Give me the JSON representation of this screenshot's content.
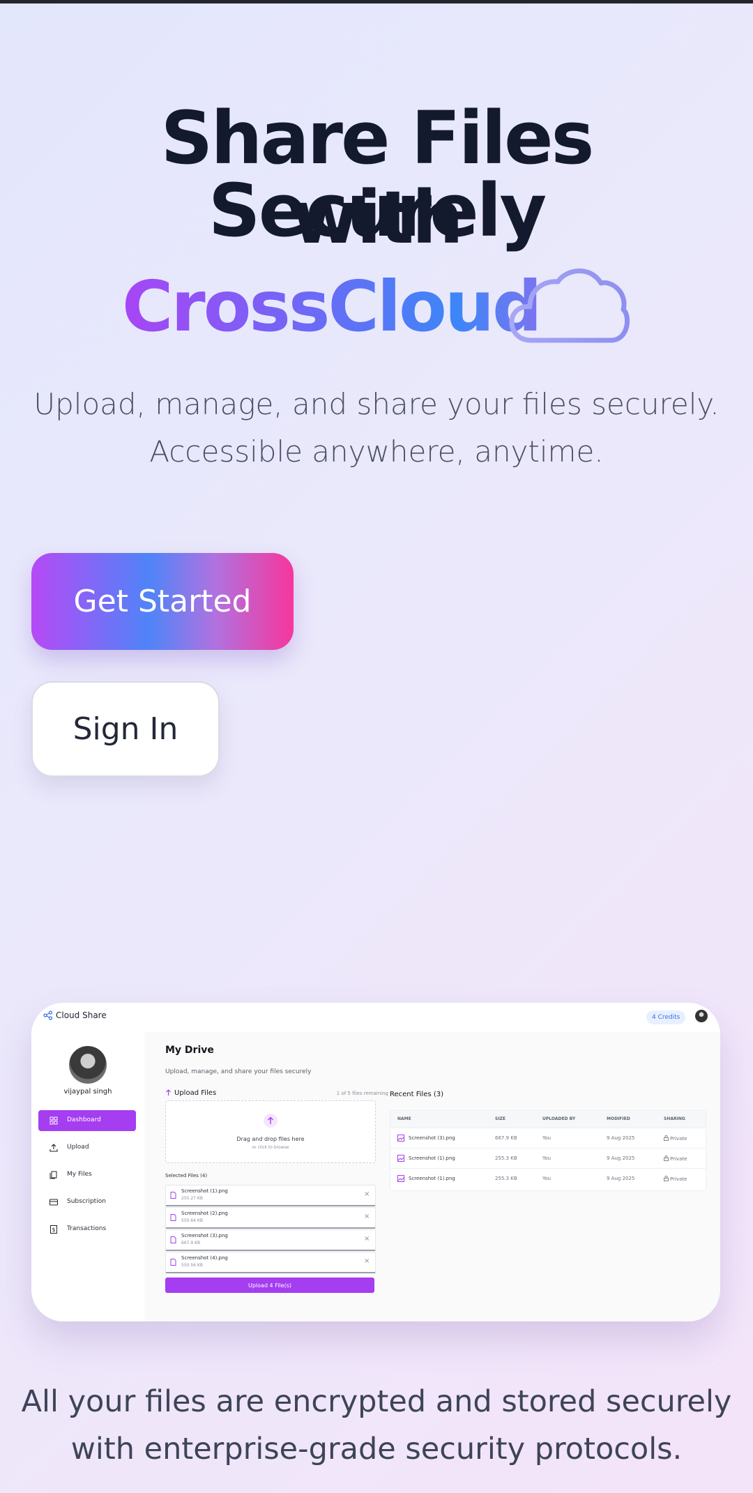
{
  "hero": {
    "title_line1": "Share Files Securely",
    "title_line2": "with",
    "brand": "CrossCloud",
    "subtitle_line1": "Upload, manage, and share your files securely.",
    "subtitle_line2": "Accessible anywhere, anytime.",
    "icons": {
      "brand": "cloud-icon"
    },
    "colors": {
      "brand_start": "#a845f5",
      "brand_end": "#3d86f7",
      "title": "#141a2e"
    }
  },
  "buttons": {
    "get_started": "Get Started",
    "sign_in": "Sign In"
  },
  "preview": {
    "app_name": "Cloud Share",
    "credits": "4 Credits",
    "user_name": "vijaypal singh",
    "sidebar": [
      {
        "label": "Dashboard",
        "icon": "dashboard-icon",
        "active": true
      },
      {
        "label": "Upload",
        "icon": "upload-icon"
      },
      {
        "label": "My Files",
        "icon": "files-icon"
      },
      {
        "label": "Subscription",
        "icon": "card-icon"
      },
      {
        "label": "Transactions",
        "icon": "receipt-icon"
      }
    ],
    "main": {
      "title": "My Drive",
      "subtitle": "Upload, manage, and share your files securely",
      "upload_heading": "Upload Files",
      "upload_remaining": "1 of 5 files remaining",
      "dropzone_text": "Drag and drop files here",
      "dropzone_subtext": "or click to browse",
      "selected_heading": "Selected Files (4)",
      "selected_files": [
        {
          "name": "Screenshot (1).png",
          "size": "255.27 KB"
        },
        {
          "name": "Screenshot (2).png",
          "size": "550.64 KB"
        },
        {
          "name": "Screenshot (3).png",
          "size": "667.9 KB"
        },
        {
          "name": "Screenshot (4).png",
          "size": "550.56 KB"
        }
      ],
      "upload_button": "Upload 4 File(s)",
      "recent_heading": "Recent Files (3)",
      "recent_columns": [
        "NAME",
        "SIZE",
        "UPLOADED BY",
        "MODIFIED",
        "SHARING"
      ],
      "recent_rows": [
        {
          "name": "Screenshot (3).png",
          "size": "667.9 KB",
          "by": "You",
          "modified": "9 Aug 2025",
          "sharing": "Private"
        },
        {
          "name": "Screenshot (1).png",
          "size": "255.3 KB",
          "by": "You",
          "modified": "9 Aug 2025",
          "sharing": "Private"
        },
        {
          "name": "Screenshot (1).png",
          "size": "255.3 KB",
          "by": "You",
          "modified": "9 Aug 2025",
          "sharing": "Private"
        }
      ],
      "accent": "#a53df0"
    }
  },
  "footer": {
    "line1": "All your files are encrypted and stored securely",
    "line2": "with enterprise-grade security protocols."
  }
}
